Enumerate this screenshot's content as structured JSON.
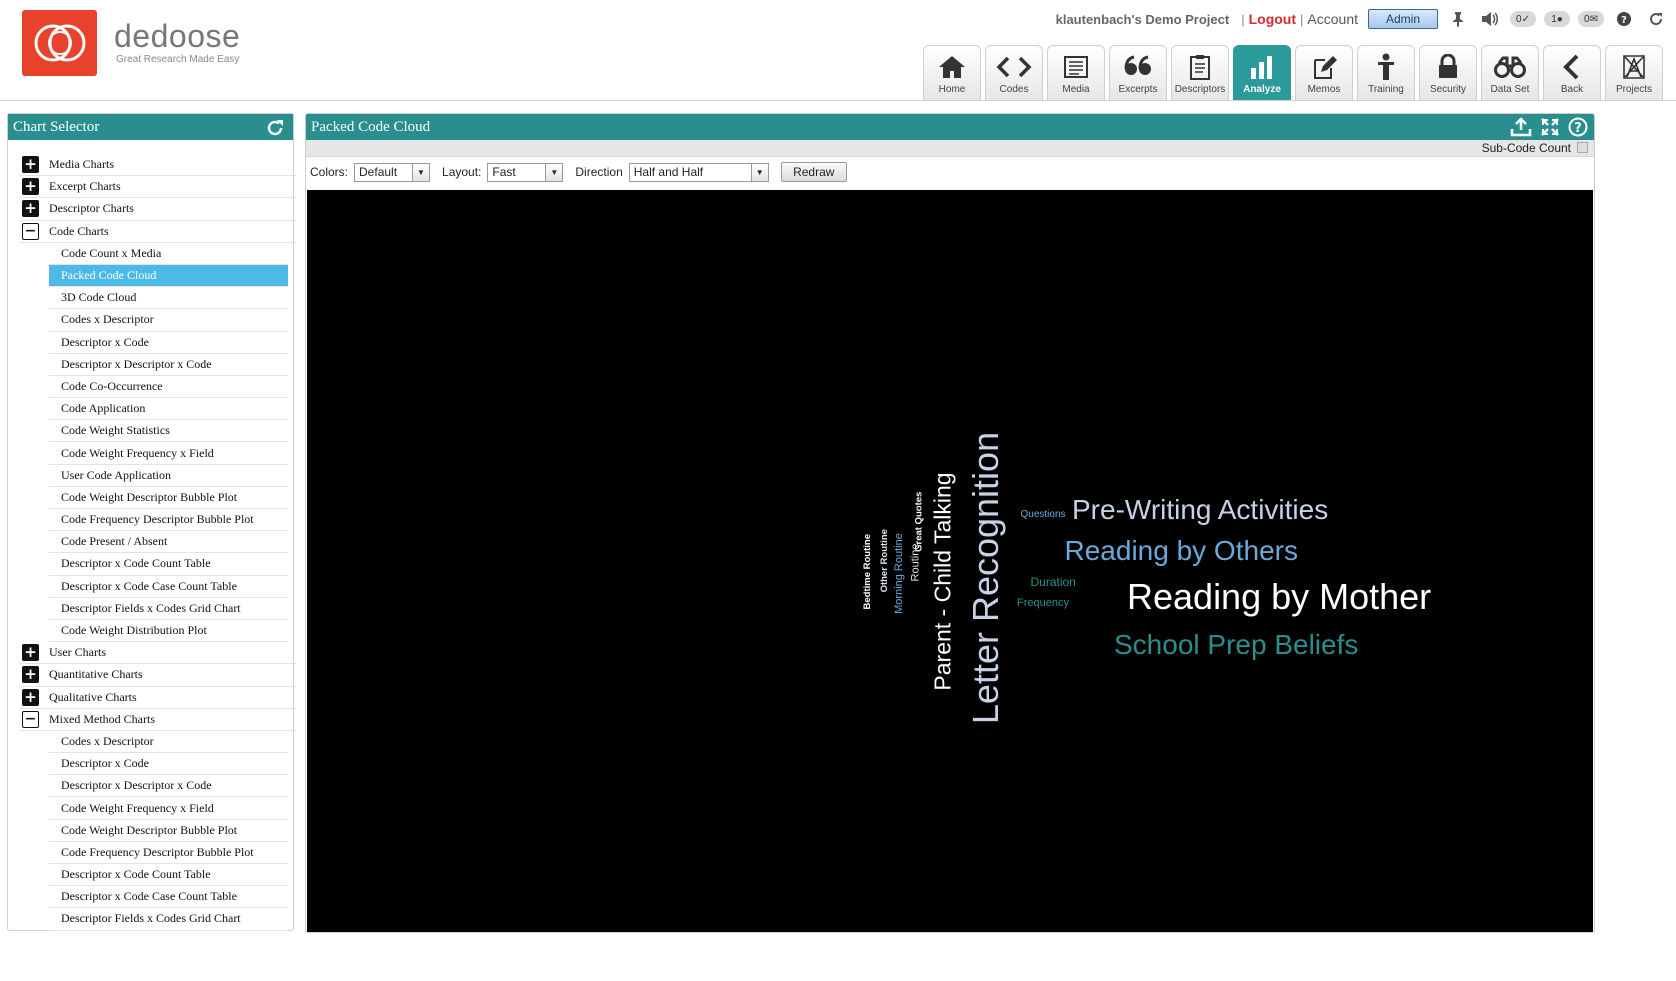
{
  "brand": {
    "name": "dedoose",
    "tagline": "Great Research Made Easy"
  },
  "topbar": {
    "project": "klautenbach's Demo Project",
    "sep": "|",
    "logout": "Logout",
    "account": "Account",
    "admin": "Admin",
    "badges": {
      "tasks": "0",
      "users": "1",
      "messages": "0"
    }
  },
  "nav": [
    {
      "label": "Home",
      "icon": "home-icon"
    },
    {
      "label": "Codes",
      "icon": "code-brackets-icon"
    },
    {
      "label": "Media",
      "icon": "media-icon"
    },
    {
      "label": "Excerpts",
      "icon": "quote-icon"
    },
    {
      "label": "Descriptors",
      "icon": "clipboard-icon"
    },
    {
      "label": "Analyze",
      "icon": "bar-chart-icon",
      "active": true
    },
    {
      "label": "Memos",
      "icon": "memo-icon"
    },
    {
      "label": "Training",
      "icon": "training-icon"
    },
    {
      "label": "Security",
      "icon": "lock-icon"
    },
    {
      "label": "Data Set",
      "icon": "binoculars-icon"
    },
    {
      "label": "Back",
      "icon": "chevron-left-icon"
    },
    {
      "label": "Projects",
      "icon": "projects-icon"
    }
  ],
  "chart_selector": {
    "title": "Chart Selector",
    "items": [
      {
        "label": "Media Charts",
        "type": "cat",
        "expanded": false
      },
      {
        "label": "Excerpt Charts",
        "type": "cat",
        "expanded": false
      },
      {
        "label": "Descriptor Charts",
        "type": "cat",
        "expanded": false
      },
      {
        "label": "Code Charts",
        "type": "cat",
        "expanded": true
      },
      {
        "label": "Code Count x Media",
        "type": "sub"
      },
      {
        "label": "Packed Code Cloud",
        "type": "sub",
        "selected": true
      },
      {
        "label": "3D Code Cloud",
        "type": "sub"
      },
      {
        "label": "Codes x Descriptor",
        "type": "sub"
      },
      {
        "label": "Descriptor x Code",
        "type": "sub"
      },
      {
        "label": "Descriptor x Descriptor x Code",
        "type": "sub"
      },
      {
        "label": "Code Co-Occurrence",
        "type": "sub"
      },
      {
        "label": "Code Application",
        "type": "sub"
      },
      {
        "label": "Code Weight Statistics",
        "type": "sub"
      },
      {
        "label": "Code Weight Frequency x Field",
        "type": "sub"
      },
      {
        "label": "User Code Application",
        "type": "sub"
      },
      {
        "label": "Code Weight Descriptor Bubble Plot",
        "type": "sub"
      },
      {
        "label": "Code Frequency Descriptor Bubble Plot",
        "type": "sub"
      },
      {
        "label": "Code Present / Absent",
        "type": "sub"
      },
      {
        "label": "Descriptor x Code Count Table",
        "type": "sub"
      },
      {
        "label": "Descriptor x Code Case Count Table",
        "type": "sub"
      },
      {
        "label": "Descriptor Fields x Codes Grid Chart",
        "type": "sub"
      },
      {
        "label": "Code Weight Distribution Plot",
        "type": "sub"
      },
      {
        "label": "User Charts",
        "type": "cat",
        "expanded": false
      },
      {
        "label": "Quantitative Charts",
        "type": "cat",
        "expanded": false
      },
      {
        "label": "Qualitative Charts",
        "type": "cat",
        "expanded": false
      },
      {
        "label": "Mixed Method Charts",
        "type": "cat",
        "expanded": true
      },
      {
        "label": "Codes x Descriptor",
        "type": "sub"
      },
      {
        "label": "Descriptor x Code",
        "type": "sub"
      },
      {
        "label": "Descriptor x Descriptor x Code",
        "type": "sub"
      },
      {
        "label": "Code Weight Frequency x Field",
        "type": "sub"
      },
      {
        "label": "Code Weight Descriptor Bubble Plot",
        "type": "sub"
      },
      {
        "label": "Code Frequency Descriptor Bubble Plot",
        "type": "sub"
      },
      {
        "label": "Descriptor x Code Count Table",
        "type": "sub"
      },
      {
        "label": "Descriptor x Code Case Count Table",
        "type": "sub"
      },
      {
        "label": "Descriptor Fields x Codes Grid Chart",
        "type": "sub"
      }
    ]
  },
  "chart_panel": {
    "title": "Packed Code Cloud",
    "subcode_label": "Sub-Code Count",
    "controls": {
      "colors_label": "Colors:",
      "colors_value": "Default",
      "layout_label": "Layout:",
      "layout_value": "Fast",
      "direction_label": "Direction",
      "direction_value": "Half and Half",
      "redraw_label": "Redraw"
    }
  },
  "cloud": {
    "background": "#000000",
    "words": [
      {
        "text": "Letter Recognition",
        "color": "#c7d2e6",
        "orientation": "vertical"
      },
      {
        "text": "Parent - Child Talking",
        "color": "#ffffff",
        "orientation": "vertical"
      },
      {
        "text": "Great Quotes",
        "color": "#ffffff",
        "orientation": "vertical"
      },
      {
        "text": "Routine",
        "color": "#dde3ec",
        "orientation": "vertical"
      },
      {
        "text": "Morning Routine",
        "color": "#6aa9d8",
        "orientation": "vertical"
      },
      {
        "text": "Other Routine",
        "color": "#dde3ec",
        "orientation": "vertical"
      },
      {
        "text": "Bedtime Routine",
        "color": "#ffffff",
        "orientation": "vertical"
      },
      {
        "text": "Questions",
        "color": "#6aa9d8",
        "orientation": "horizontal"
      },
      {
        "text": "Pre-Writing Activities",
        "color": "#c7d2e6",
        "orientation": "horizontal"
      },
      {
        "text": "Reading by Others",
        "color": "#6aa9d8",
        "orientation": "horizontal"
      },
      {
        "text": "Duration",
        "color": "#2a8e8e",
        "orientation": "horizontal"
      },
      {
        "text": "Frequency",
        "color": "#2a8e8e",
        "orientation": "horizontal"
      },
      {
        "text": "Reading by Mother",
        "color": "#ffffff",
        "orientation": "horizontal"
      },
      {
        "text": "School Prep Beliefs",
        "color": "#2a8e8e",
        "orientation": "horizontal"
      }
    ]
  },
  "colors": {
    "accent": "#2a8e8e",
    "brand": "#e8412c",
    "selected": "#4cb9e7",
    "logout": "#d9272e"
  }
}
